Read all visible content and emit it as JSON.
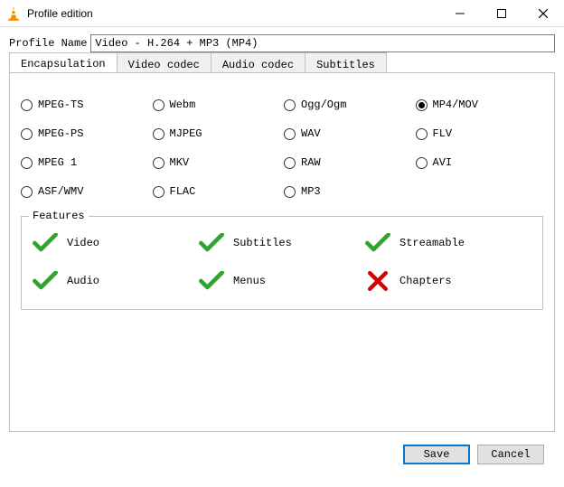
{
  "window": {
    "title": "Profile edition"
  },
  "profile": {
    "label": "Profile Name",
    "value": "Video - H.264 + MP3 (MP4)"
  },
  "tabs": {
    "items": [
      {
        "label": "Encapsulation"
      },
      {
        "label": "Video codec"
      },
      {
        "label": "Audio codec"
      },
      {
        "label": "Subtitles"
      }
    ]
  },
  "encapsulation": {
    "options": [
      {
        "label": "MPEG-TS",
        "selected": false
      },
      {
        "label": "Webm",
        "selected": false
      },
      {
        "label": "Ogg/Ogm",
        "selected": false
      },
      {
        "label": "MP4/MOV",
        "selected": true
      },
      {
        "label": "MPEG-PS",
        "selected": false
      },
      {
        "label": "MJPEG",
        "selected": false
      },
      {
        "label": "WAV",
        "selected": false
      },
      {
        "label": "FLV",
        "selected": false
      },
      {
        "label": "MPEG 1",
        "selected": false
      },
      {
        "label": "MKV",
        "selected": false
      },
      {
        "label": "RAW",
        "selected": false
      },
      {
        "label": "AVI",
        "selected": false
      },
      {
        "label": "ASF/WMV",
        "selected": false
      },
      {
        "label": "FLAC",
        "selected": false
      },
      {
        "label": "MP3",
        "selected": false
      }
    ]
  },
  "features": {
    "legend": "Features",
    "items": [
      {
        "label": "Video",
        "supported": true
      },
      {
        "label": "Subtitles",
        "supported": true
      },
      {
        "label": "Streamable",
        "supported": true
      },
      {
        "label": "Audio",
        "supported": true
      },
      {
        "label": "Menus",
        "supported": true
      },
      {
        "label": "Chapters",
        "supported": false
      }
    ]
  },
  "buttons": {
    "save": "Save",
    "cancel": "Cancel"
  }
}
